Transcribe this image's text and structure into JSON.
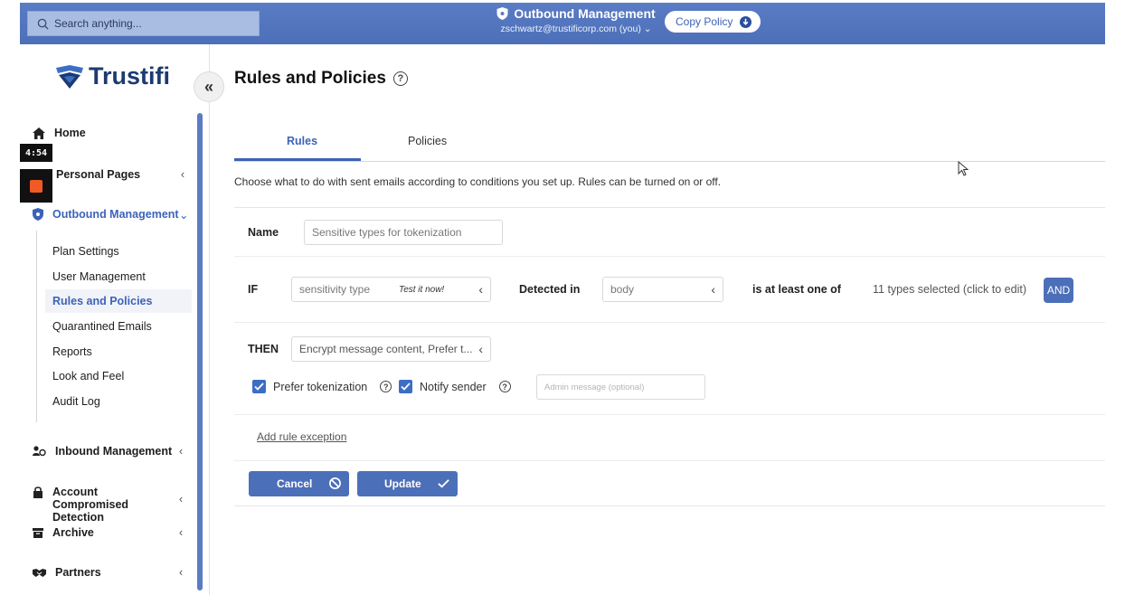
{
  "topbar": {
    "search_placeholder": "Search anything...",
    "title": "Outbound Management",
    "user": "zschwartz@trustificorp.com (you) ⌄",
    "copy_policy": "Copy Policy"
  },
  "recorder": {
    "timer": "4:54"
  },
  "sidebar": {
    "logo": "Trustifi",
    "items": [
      {
        "label": "Home",
        "icon": "home-icon"
      },
      {
        "label": "Personal Pages",
        "icon": "person-icon",
        "chevron": "‹"
      },
      {
        "label": "Outbound Management",
        "icon": "shield-icon",
        "chevron": "⌄"
      },
      {
        "label": "Inbound Management",
        "icon": "users-icon",
        "chevron": "‹"
      },
      {
        "label": "Account Compromised Detection",
        "icon": "lock-icon",
        "chevron": "‹"
      },
      {
        "label": "Archive",
        "icon": "archive-icon",
        "chevron": "‹"
      },
      {
        "label": "Partners",
        "icon": "handshake-icon",
        "chevron": "‹"
      }
    ],
    "subitems": [
      "Plan Settings",
      "User Management",
      "Rules and Policies",
      "Quarantined Emails",
      "Reports",
      "Look and Feel",
      "Audit Log"
    ],
    "collapse_icon": "«"
  },
  "main": {
    "title": "Rules and Policies",
    "tabs": [
      "Rules",
      "Policies"
    ],
    "description": "Choose what to do with sent emails according to conditions you set up. Rules can be turned on or off.",
    "rule": {
      "name_label": "Name",
      "name_value": "Sensitive types for tokenization",
      "if_label": "IF",
      "condition": "sensitivity type",
      "test_link": "Test it now!",
      "detected_in_label": "Detected in",
      "detected_in_value": "body",
      "operator": "is at least one of",
      "types_selected": "11 types selected (click to edit)",
      "and_button": "AND",
      "then_label": "THEN",
      "action": "Encrypt message content, Prefer t...",
      "prefer_tokenization": "Prefer tokenization",
      "notify_sender": "Notify sender",
      "admin_placeholder": "Admin message (optional)",
      "add_exception": "Add rule exception",
      "cancel": "Cancel",
      "update": "Update"
    }
  },
  "colors": {
    "accent": "#4c6fb9",
    "active": "#3c63b8"
  }
}
